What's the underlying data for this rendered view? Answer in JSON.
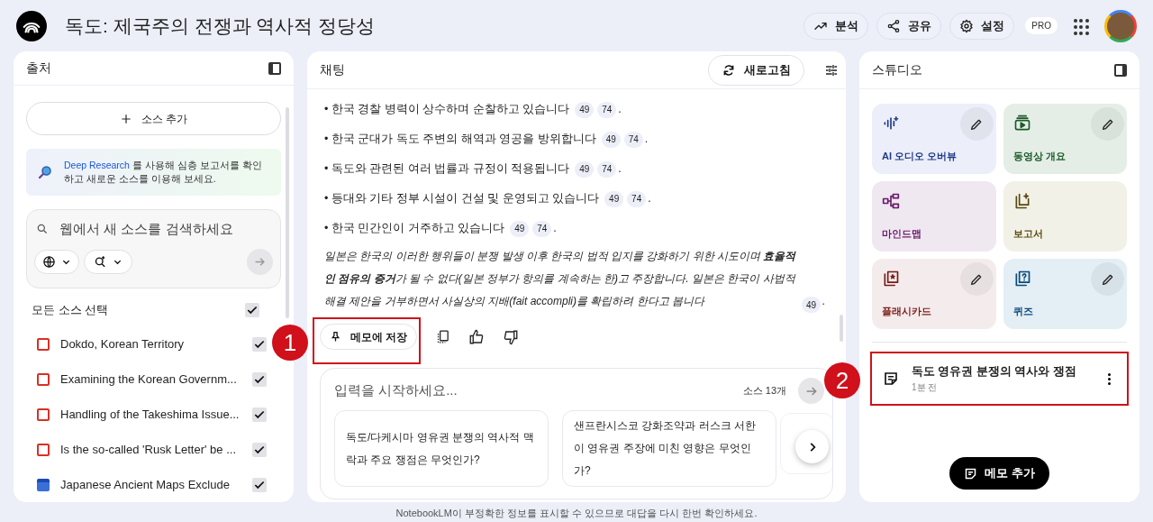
{
  "header": {
    "title": "독도: 제국주의 전쟁과 역사적 정당성",
    "actions": [
      {
        "kind": "analytics",
        "label": "분석"
      },
      {
        "kind": "share",
        "label": "공유"
      },
      {
        "kind": "settings",
        "label": "설정"
      }
    ],
    "badge": "PRO"
  },
  "sources": {
    "title": "출처",
    "add_button": "소스 추가",
    "promo": "**Deep Research** 를 사용해 심층 보고서를 확인하고 새로운 소스를 이용해 보세요.",
    "search": {
      "placeholder": "웹에서 새 소스를 검색하세요"
    },
    "select_all": {
      "label": "모든 소스 선택",
      "checked": true
    },
    "items": [
      {
        "kind": "pdf",
        "label": "Dokdo, Korean Territory",
        "checked": true
      },
      {
        "kind": "pdf",
        "label": "Examining the Korean Governm...",
        "checked": true
      },
      {
        "kind": "pdf",
        "label": "Handling of the Takeshima Issue...",
        "checked": true
      },
      {
        "kind": "pdf",
        "label": "Is the so-called 'Rusk Letter' be ...",
        "checked": true
      },
      {
        "kind": "doc",
        "label": "Japanese Ancient Maps Exclude",
        "checked": true
      }
    ]
  },
  "chat": {
    "title": "채팅",
    "refresh_button": "새로고침",
    "bullets": [
      {
        "text": "• 한국 경찰 병력이 상수하며 순찰하고 있습니다",
        "citations": [
          "49",
          "74"
        ],
        "end": "."
      },
      {
        "text": "• 한국 군대가 독도 주변의 해역과 영공을 방위합니다",
        "citations": [
          "49",
          "74"
        ],
        "end": "."
      },
      {
        "text": "• 독도와 관련된 여러 법률과 규정이 적용됩니다",
        "citations": [
          "49",
          "74"
        ],
        "end": "."
      },
      {
        "text": "• 등대와 기타 정부 시설이 건설 및 운영되고 있습니다",
        "citations": [
          "49",
          "74"
        ],
        "end": "."
      },
      {
        "text": "• 한국 민간인이 거주하고 있습니다",
        "citations": [
          "49",
          "74"
        ],
        "end": "."
      }
    ],
    "paragraph": {
      "text": "일본은 한국의 이러한 행위들이 분쟁 발생 이후 한국의 법적 입지를 강화하기 위한 시도이며 **효율적인 점유의 증거**가 될 수 없다(일본 정부가 항의를 계속하는 한)고 주장합니다. 일본은 한국이 사법적 해결 제안을 거부하면서 사실상의 지배(fait accompli)를 확립하려 한다고 봅니다",
      "citations": [
        "49"
      ],
      "end": "."
    },
    "save_button": "메모에 저장",
    "input": {
      "placeholder": "입력을 시작하세요...",
      "source_count": "소스 13개"
    },
    "suggestions": [
      "독도/다케시마 영유권 분쟁의 역사적 맥락과 주요 쟁점은 무엇인가?",
      "샌프란시스코 강화조약과 러스크 서한이 영유권 주장에 미친 영향은 무엇인가?"
    ]
  },
  "studio": {
    "title": "스튜디오",
    "tiles": [
      {
        "kind": "audio",
        "label": "AI 오디오 오버뷰",
        "editable": true,
        "color": "#eceff9"
      },
      {
        "kind": "video",
        "label": "동영상 개요",
        "editable": true,
        "color": "#e4eee6"
      },
      {
        "kind": "mindmap",
        "label": "마인드맵",
        "editable": false,
        "color": "#efe8f0"
      },
      {
        "kind": "report",
        "label": "보고서",
        "editable": false,
        "color": "#f2f1e8"
      },
      {
        "kind": "flashcard",
        "label": "플래시카드",
        "editable": true,
        "color": "#f4ecec"
      },
      {
        "kind": "quiz",
        "label": "퀴즈",
        "editable": true,
        "color": "#e3eef5"
      }
    ],
    "note": {
      "title": "독도 영유권 분쟁의 역사와 쟁점",
      "time": "1분 전"
    },
    "add_note_button": "메모 추가"
  },
  "annotations": [
    "1",
    "2"
  ],
  "footer": "NotebookLM이 부정확한 정보를 표시할 수 있으므로 대답을 다시 한번 확인하세요."
}
